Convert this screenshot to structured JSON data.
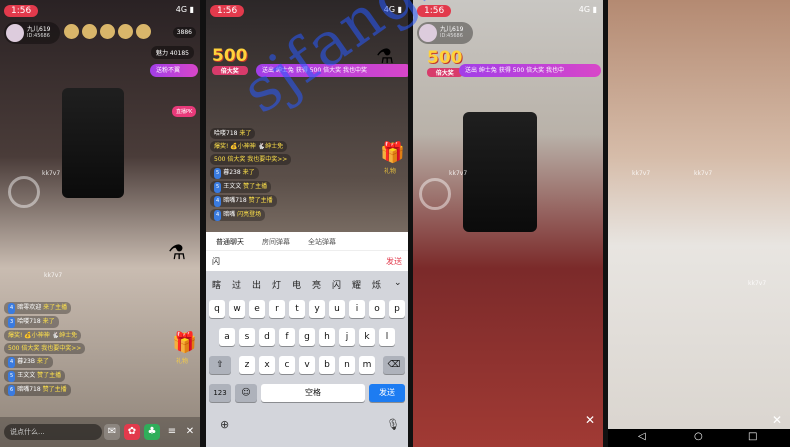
{
  "panel1": {
    "time": "1:56",
    "status": "4G",
    "anchor_name": "九儿619",
    "anchor_sub": "ID:45686",
    "viewer_count": "3886",
    "charm": "魅力 40185",
    "marquee": "送粉不翼",
    "pk_label": "直播PK",
    "watermark": "kk7v7",
    "chat": [
      {
        "lvl": "4",
        "text": "暗零欢迎",
        "hl": "来了主播"
      },
      {
        "lvl": "3",
        "text": "哈喽718",
        "hl": "来了"
      },
      {
        "lvl": "",
        "text": "爆奖! 💰小神神 🐇绅士免",
        "hl": ""
      },
      {
        "lvl": "",
        "text": "500 倍大奖 我也要中奖>>",
        "hl": ""
      },
      {
        "lvl": "4",
        "text": "暮23B",
        "hl": "来了"
      },
      {
        "lvl": "5",
        "text": "王文文",
        "hl": "赞了主播"
      },
      {
        "lvl": "6",
        "text": "暗嘴718",
        "hl": "赞了主播"
      }
    ],
    "say_placeholder": "说点什么...",
    "gift_label": "礼物"
  },
  "panel2": {
    "time": "1:56",
    "status": "4G",
    "big_500": "500",
    "big_500_sub": "倍大奖",
    "marquee": "送出 绅士兔 获得 500 倍大奖 我也中奖",
    "gift_label": "礼物",
    "chat": [
      {
        "lvl": "",
        "text": "哈喽718",
        "hl": "来了"
      },
      {
        "lvl": "",
        "text": "爆奖! 💰小神神 🐇绅士免",
        "hl": ""
      },
      {
        "lvl": "",
        "text": "500 倍大奖 我也要中奖>>",
        "hl": ""
      },
      {
        "lvl": "5",
        "text": "暮238",
        "hl": "来了"
      },
      {
        "lvl": "5",
        "text": "王文文",
        "hl": "赞了主播"
      },
      {
        "lvl": "4",
        "text": "暗嘴718",
        "hl": "赞了主播"
      },
      {
        "lvl": "4",
        "text": "暗嘴",
        "hl": "闪亮登场"
      }
    ],
    "keyboard": {
      "tabs": [
        "普通聊天",
        "房间弹幕",
        "全站弹幕"
      ],
      "input_text": "闪",
      "send": "发送",
      "candidates": [
        "瞎",
        "过",
        "出",
        "灯",
        "电",
        "亮",
        "闪",
        "耀",
        "烁"
      ],
      "row1": [
        "q",
        "w",
        "e",
        "r",
        "t",
        "y",
        "u",
        "i",
        "o",
        "p"
      ],
      "row2": [
        "a",
        "s",
        "d",
        "f",
        "g",
        "h",
        "j",
        "k",
        "l"
      ],
      "row3": [
        "z",
        "x",
        "c",
        "v",
        "b",
        "n",
        "m"
      ],
      "num": "123",
      "space": "空格",
      "send_key": "发送"
    }
  },
  "panel3": {
    "time": "1:56",
    "status": "4G",
    "anchor_name": "九儿619",
    "anchor_sub": "ID:45686",
    "big_500": "500",
    "big_500_sub": "倍大奖",
    "marquee": "送出 绅士兔 获得 500 倍大奖 我也中",
    "watermark": "kk7v7"
  },
  "panel4": {
    "watermark": "kk7v7",
    "close": "✕"
  },
  "site_watermark": "sjfangktv.com"
}
